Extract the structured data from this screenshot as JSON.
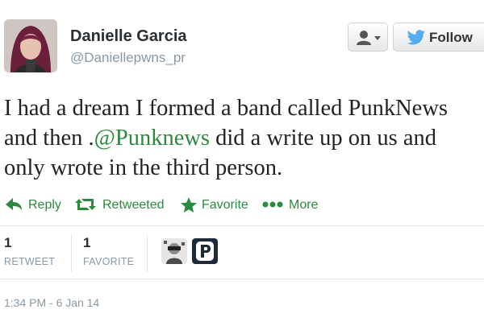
{
  "header": {
    "display_name": "Danielle Garcia",
    "screen_name": "@Daniellepwns_pr",
    "follow_label": "Follow"
  },
  "tweet": {
    "text_before": "I had a dream I formed a band called PunkNews and then .",
    "mention": "@Punknews",
    "text_after": " did a write up on us and only wrote in the third person."
  },
  "actions": {
    "reply": "Reply",
    "retweet": "Retweeted",
    "favorite": "Favorite",
    "more": "More"
  },
  "stats": {
    "retweets": {
      "count": "1",
      "label": "RETWEET"
    },
    "favorites": {
      "count": "1",
      "label": "FAVORITE"
    }
  },
  "timestamp": "1:34 PM - 6 Jan 14",
  "colors": {
    "action_green": "#2a8a3e",
    "follow_bird_blue": "#55acee",
    "muted_text": "#8899a6"
  },
  "icons": [
    "avatar",
    "user-icon",
    "chevron-down-icon",
    "twitter-bird-icon",
    "reply-arrow-icon",
    "retweet-icon",
    "star-icon",
    "more-dots-icon"
  ]
}
